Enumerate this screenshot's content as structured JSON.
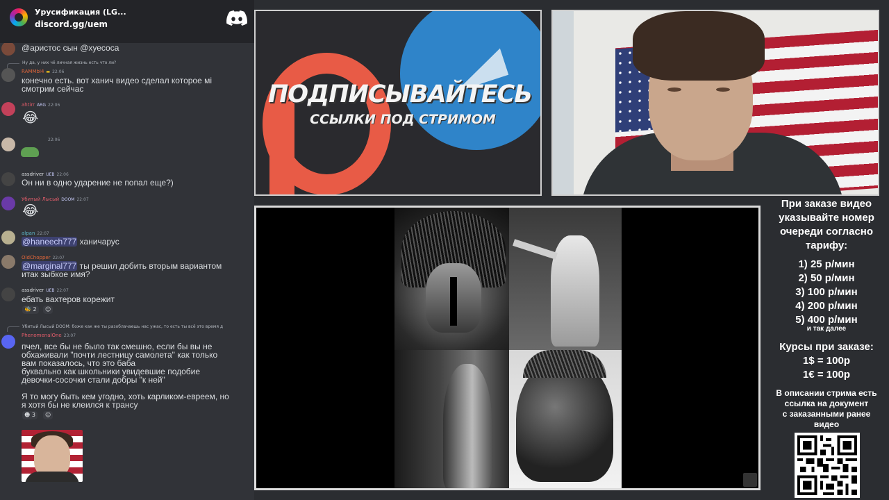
{
  "server": {
    "name": "Урусификация (LG...",
    "invite": "discord.gg/uem",
    "icon": "server-icon"
  },
  "chat": [
    {
      "text": "@аристос сын @хуесоса"
    },
    {
      "reply": "Ну да, у них чё личная жизнь есть что ли?",
      "user": "RAMMbI4",
      "user_color": "#e0663a",
      "time": "22:06",
      "text": "конечно есть. вот ханич видео сделал которое мі\nсмотрим сейчас"
    },
    {
      "user": "ahtirr",
      "user_color": "#e35d6a",
      "badge": "ARG",
      "time": "22:06",
      "emoji": "😂"
    },
    {
      "time": "22:06",
      "sticker": "pepe-sticker"
    },
    {
      "user": "assdriver",
      "user_color": "#dbdee1",
      "badge": "UEB",
      "time": "22:06",
      "text": "Он ни в одно ударение не попал еще?)"
    },
    {
      "user": "Убитый Лысый",
      "user_color": "#e35d6a",
      "badge": "DOOM",
      "time": "22:07",
      "emoji": "😂"
    },
    {
      "user": "alpan",
      "user_color": "#5db7c9",
      "time": "22:07",
      "mention": "@haneech777",
      "text": " ханичарус"
    },
    {
      "user": "OldChopper",
      "user_color": "#e0663a",
      "time": "22:07",
      "mention": "@marginal777",
      "text": " ты решил добить вторым вариантом\nитак зыбкое имя?"
    },
    {
      "user": "assdriver",
      "user_color": "#dbdee1",
      "badge": "UEB",
      "time": "22:07",
      "text": "ебать вахтеров корежит",
      "reaction_count": "2"
    },
    {
      "reply": "Убитый Лысый DOOM: боже как же ты разоблачаешь нас ужас, то есть ты всё это время д",
      "user": "PhenomenalOne",
      "user_color": "#e35d6a",
      "time": "23:07",
      "text": "пчел, все бы не было так смешно, если бы вы не\nобхаживали \"почти лестницу самолета\" как только\nвам показалось, что это баба\nбуквально как школьники увидевшие подобие\nдевочки-сосочки стали добры \"к ней\"\n\nЯ то могу быть кем угодно, хоть карликом-евреем, но\nя хотя бы не клеился к трансу",
      "reaction_count": "3"
    }
  ],
  "banner": {
    "title": "ПОДПИСЫВАЙТЕСЬ",
    "subtitle": "ССЫЛКИ ПОД СТРИМОМ"
  },
  "info": {
    "heading": [
      "При заказе видео",
      "указывайте номер",
      "очереди согласно",
      "тарифу:"
    ],
    "tariffs": [
      "1) 25 р/мин",
      "2) 50 р/мин",
      "3) 100 р/мин",
      "4) 200 р/мин",
      "5) 400 р/мин"
    ],
    "and_more": "и так далее",
    "courses_title": "Курсы при заказе:",
    "courses": [
      "1$ = 100р",
      "1€ = 100р"
    ],
    "description": [
      "В описании стрима есть",
      "ссылка на документ",
      "с заказанными ранее",
      "видео"
    ]
  },
  "colors": {
    "chat_bg": "#313338",
    "patreon": "#e85b46",
    "telegram": "#2f84c9",
    "mention_bg": "#3c4270"
  }
}
